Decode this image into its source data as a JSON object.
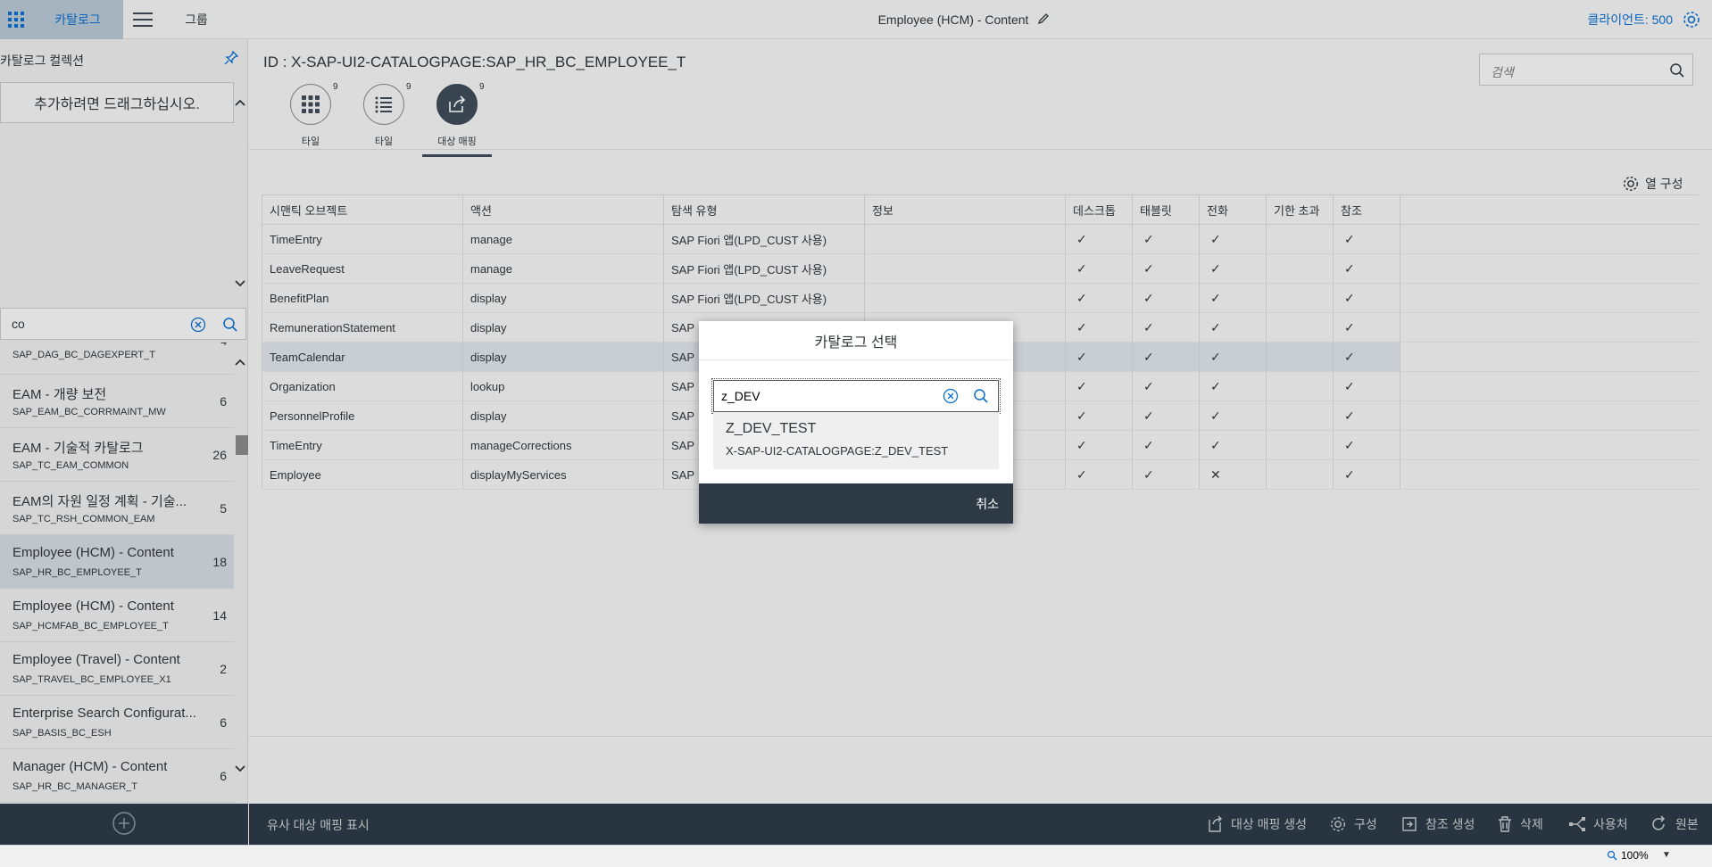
{
  "shellbar": {
    "catalog_tab": "카탈로그",
    "group_tab": "그룹",
    "title": "Employee (HCM) - Content",
    "client": "클라이언트: 500"
  },
  "left": {
    "header": "카탈로그 컬렉션",
    "dropzone": "추가하려면 드래그하십시오.",
    "search_value": "co",
    "partial_item": {
      "sub": "SAP_DAG_BC_DAGEXPERT_T",
      "count": "4"
    },
    "items": [
      {
        "title": "EAM - 개량 보전",
        "sub": "SAP_EAM_BC_CORRMAINT_MW",
        "count": "6"
      },
      {
        "title": "EAM - 기술적 카탈로그",
        "sub": "SAP_TC_EAM_COMMON",
        "count": "26"
      },
      {
        "title": "EAM의 자원 일정 계획 - 기술...",
        "sub": "SAP_TC_RSH_COMMON_EAM",
        "count": "5"
      },
      {
        "title": "Employee (HCM) - Content",
        "sub": "SAP_HR_BC_EMPLOYEE_T",
        "count": "18"
      },
      {
        "title": "Employee (HCM) - Content",
        "sub": "SAP_HCMFAB_BC_EMPLOYEE_T",
        "count": "14"
      },
      {
        "title": "Employee (Travel) - Content",
        "sub": "SAP_TRAVEL_BC_EMPLOYEE_X1",
        "count": "2"
      },
      {
        "title": "Enterprise Search Configurat...",
        "sub": "SAP_BASIS_BC_ESH",
        "count": "6"
      },
      {
        "title": "Manager (HCM) - Content",
        "sub": "SAP_HR_BC_MANAGER_T",
        "count": "6"
      }
    ]
  },
  "main": {
    "id_label": "ID : X-SAP-UI2-CATALOGPAGE:SAP_HR_BC_EMPLOYEE_T",
    "search_placeholder": "검색",
    "tabs": [
      {
        "label": "타일",
        "badge": "9"
      },
      {
        "label": "타일",
        "badge": "9"
      },
      {
        "label": "대상 매핑",
        "badge": "9"
      }
    ],
    "col_config": "열 구성",
    "columns": [
      "시맨틱 오브젝트",
      "액션",
      "탐색 유형",
      "정보",
      "데스크톱",
      "태블릿",
      "전화",
      "기한 초과",
      "참조"
    ],
    "rows": [
      {
        "obj": "TimeEntry",
        "action": "manage",
        "nav": "SAP Fiori 앱(LPD_CUST 사용)",
        "info": "",
        "desktop": "✓",
        "tablet": "✓",
        "phone": "✓",
        "overdue": "",
        "ref": "✓"
      },
      {
        "obj": "LeaveRequest",
        "action": "manage",
        "nav": "SAP Fiori 앱(LPD_CUST 사용)",
        "info": "",
        "desktop": "✓",
        "tablet": "✓",
        "phone": "✓",
        "overdue": "",
        "ref": "✓"
      },
      {
        "obj": "BenefitPlan",
        "action": "display",
        "nav": "SAP Fiori 앱(LPD_CUST 사용)",
        "info": "",
        "desktop": "✓",
        "tablet": "✓",
        "phone": "✓",
        "overdue": "",
        "ref": "✓"
      },
      {
        "obj": "RemunerationStatement",
        "action": "display",
        "nav": "SAP",
        "info": "",
        "desktop": "✓",
        "tablet": "✓",
        "phone": "✓",
        "overdue": "",
        "ref": "✓"
      },
      {
        "obj": "TeamCalendar",
        "action": "display",
        "nav": "SAP",
        "info": "",
        "desktop": "✓",
        "tablet": "✓",
        "phone": "✓",
        "overdue": "",
        "ref": "✓"
      },
      {
        "obj": "Organization",
        "action": "lookup",
        "nav": "SAP",
        "info": "",
        "desktop": "✓",
        "tablet": "✓",
        "phone": "✓",
        "overdue": "",
        "ref": "✓"
      },
      {
        "obj": "PersonnelProfile",
        "action": "display",
        "nav": "SAP",
        "info": "",
        "desktop": "✓",
        "tablet": "✓",
        "phone": "✓",
        "overdue": "",
        "ref": "✓"
      },
      {
        "obj": "TimeEntry",
        "action": "manageCorrections",
        "nav": "SAP",
        "info": "",
        "desktop": "✓",
        "tablet": "✓",
        "phone": "✓",
        "overdue": "",
        "ref": "✓"
      },
      {
        "obj": "Employee",
        "action": "displayMyServices",
        "nav": "SAP",
        "info": "",
        "desktop": "✓",
        "tablet": "✓",
        "phone": "✕",
        "overdue": "",
        "ref": "✓"
      }
    ]
  },
  "dialog": {
    "title": "카탈로그 선택",
    "input_value": "z_DEV",
    "result_title": "Z_DEV_TEST",
    "result_sub": "X-SAP-UI2-CATALOGPAGE:Z_DEV_TEST",
    "cancel": "취소"
  },
  "footer": {
    "show_similar": "유사 대상 매핑 표시",
    "buttons": [
      "대상 매핑 생성",
      "구성",
      "참조 생성",
      "삭제",
      "사용처",
      "원본"
    ]
  },
  "statusbar": {
    "zoom": "100%"
  }
}
